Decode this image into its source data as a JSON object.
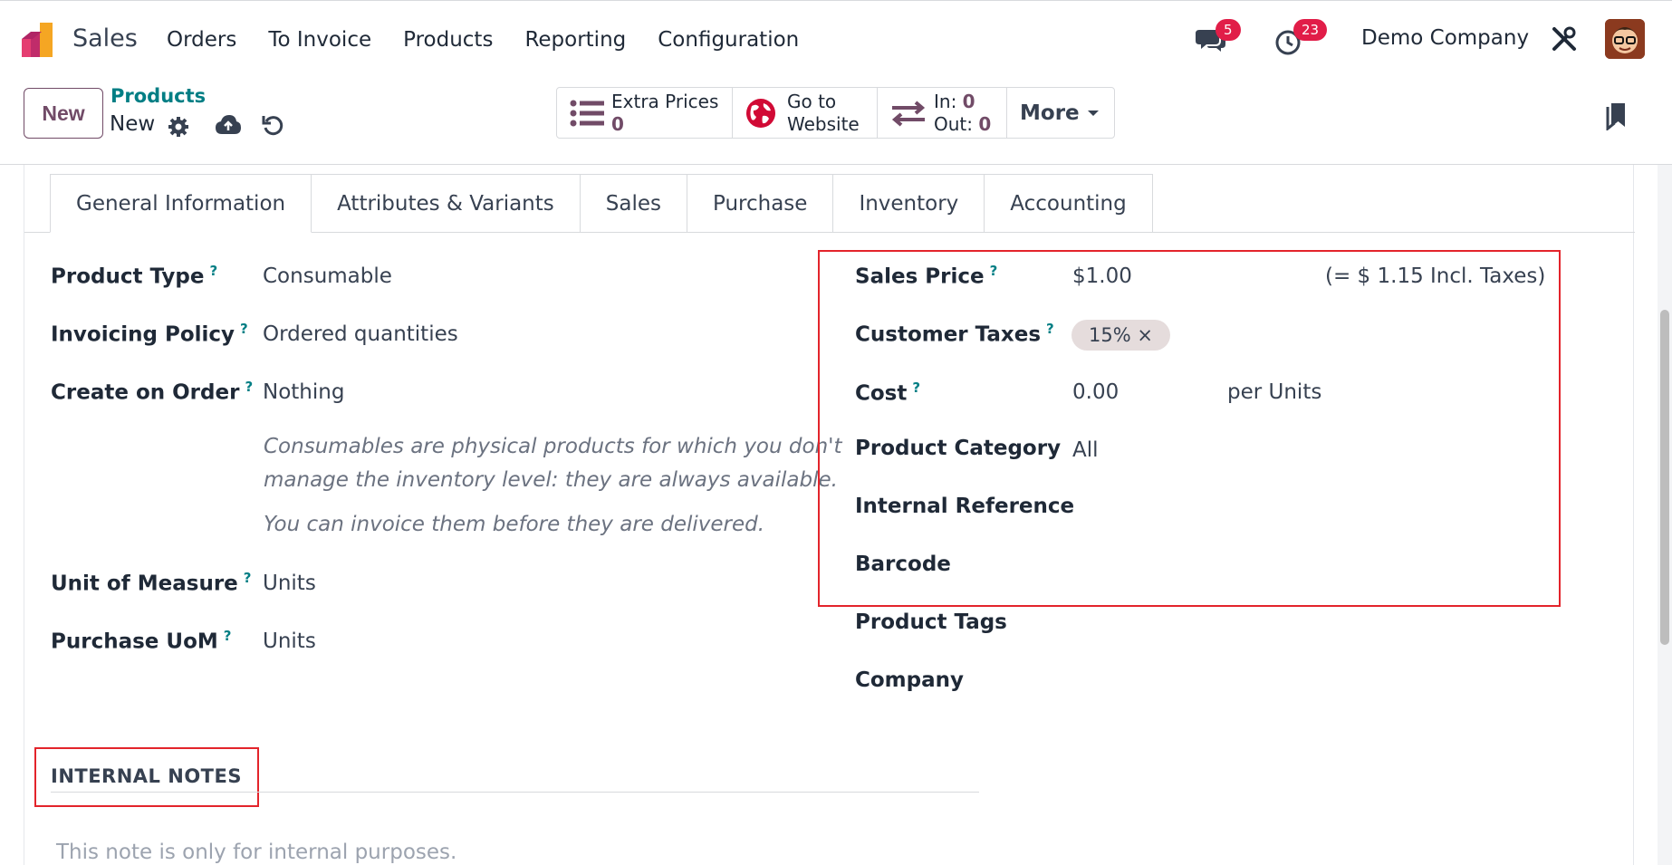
{
  "topbar": {
    "app_name": "Sales",
    "menu": [
      "Orders",
      "To Invoice",
      "Products",
      "Reporting",
      "Configuration"
    ],
    "messages_badge": "5",
    "activities_badge": "23",
    "company": "Demo Company"
  },
  "control": {
    "new_label": "New",
    "breadcrumb_parent": "Products",
    "breadcrumb_current": "New",
    "smart_buttons": {
      "extra_prices_label": "Extra Prices",
      "extra_prices_value": "0",
      "website_line1": "Go to",
      "website_line2": "Website",
      "in_label": "In:",
      "in_value": "0",
      "out_label": "Out:",
      "out_value": "0",
      "more_label": "More"
    }
  },
  "tabs": [
    "General Information",
    "Attributes & Variants",
    "Sales",
    "Purchase",
    "Inventory",
    "Accounting"
  ],
  "left_fields": {
    "product_type_label": "Product Type",
    "product_type_value": "Consumable",
    "invoicing_policy_label": "Invoicing Policy",
    "invoicing_policy_value": "Ordered quantities",
    "create_on_order_label": "Create on Order",
    "create_on_order_value": "Nothing",
    "help_line1": "Consumables are physical products for which you don't",
    "help_line2": "manage the inventory level: they are always available.",
    "help_line3": "You can invoice them before they are delivered.",
    "uom_label": "Unit of Measure",
    "uom_value": "Units",
    "purchase_uom_label": "Purchase UoM",
    "purchase_uom_value": "Units"
  },
  "right_fields": {
    "sales_price_label": "Sales Price",
    "sales_price_value": "$1.00",
    "sales_price_incl": "(= $ 1.15 Incl. Taxes)",
    "customer_taxes_label": "Customer Taxes",
    "customer_taxes_tag": "15% ×",
    "cost_label": "Cost",
    "cost_value": "0.00",
    "cost_unit": "per Units",
    "category_label": "Product Category",
    "category_value": "All",
    "internal_ref_label": "Internal Reference",
    "barcode_label": "Barcode",
    "tags_label": "Product Tags",
    "company_label": "Company"
  },
  "notes": {
    "title": "INTERNAL NOTES",
    "placeholder": "This note is only for internal purposes."
  },
  "help_marker": "?",
  "colors": {
    "brand": "#714b67",
    "link": "#017e84",
    "badge": "#e11d48",
    "highlight": "#e3242b"
  }
}
